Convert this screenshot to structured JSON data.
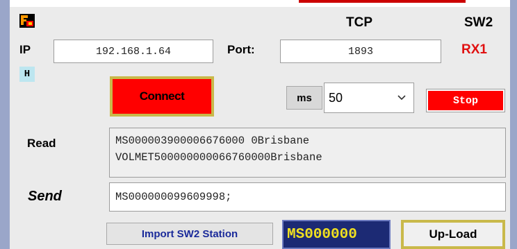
{
  "header": {
    "protocol": "TCP",
    "switch": "SW2",
    "channel": "RX1"
  },
  "connection": {
    "ip_label": "IP",
    "ip_value": "192.168.1.64",
    "port_label": "Port:",
    "port_value": "1893",
    "h_badge": "H",
    "connect_label": "Connect"
  },
  "timing": {
    "ms_label": "ms",
    "ms_value": "50",
    "stop_label": "Stop"
  },
  "read": {
    "label": "Read",
    "lines": [
      "MS000003900006676000 0Brisbane",
      "VOLMET500000000066760000Brisbane"
    ]
  },
  "send": {
    "label": "Send",
    "value": "MS000000099609998;"
  },
  "footer": {
    "import_label": "Import SW2 Station",
    "display_value": "MS000000",
    "upload_label": "Up-Load"
  },
  "colors": {
    "accent_red": "#ff0000",
    "frame": "#9aa6c9",
    "display_bg": "#1c2a74",
    "display_fg": "#f0e020",
    "gold_border": "#c9b94a"
  }
}
